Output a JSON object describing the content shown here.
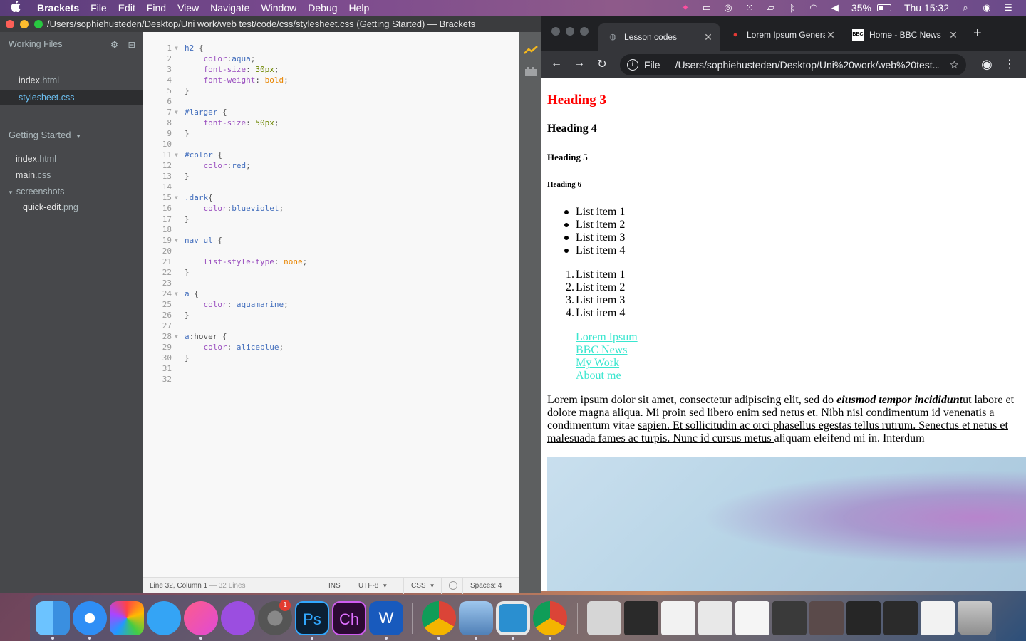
{
  "menubar": {
    "app_name": "Brackets",
    "menus": [
      "File",
      "Edit",
      "Find",
      "View",
      "Navigate",
      "Window",
      "Debug",
      "Help"
    ],
    "battery_percent": "35%",
    "clock": "Thu 15:32"
  },
  "brackets": {
    "title": "/Users/sophiehusteden/Desktop/Uni work/web test/code/css/stylesheet.css (Getting Started) — Brackets",
    "working_files_label": "Working Files",
    "working_files": [
      {
        "name": "index",
        "ext": ".html"
      },
      {
        "name": "stylesheet",
        "ext": ".css"
      }
    ],
    "project_title": "Getting Started",
    "project_tree": [
      {
        "name": "index",
        "ext": ".html"
      },
      {
        "name": "main",
        "ext": ".css"
      },
      {
        "name": "screenshots",
        "ext": ""
      },
      {
        "name": "quick-edit",
        "ext": ".png"
      }
    ],
    "line_numbers": [
      "1",
      "2",
      "3",
      "4",
      "5",
      "6",
      "7",
      "8",
      "9",
      "10",
      "11",
      "12",
      "13",
      "14",
      "15",
      "16",
      "17",
      "18",
      "19",
      "20",
      "21",
      "22",
      "23",
      "24",
      "25",
      "26",
      "27",
      "28",
      "29",
      "30",
      "31",
      "32"
    ],
    "status": {
      "position": "Line 32, Column 1",
      "lines": "— 32 Lines",
      "mode": "INS",
      "encoding": "UTF-8",
      "language": "CSS",
      "spaces": "Spaces:  4"
    }
  },
  "chrome": {
    "tabs": [
      {
        "title": "Lesson codes"
      },
      {
        "title": "Lorem Ipsum Generator"
      },
      {
        "title": "Home - BBC News"
      }
    ],
    "bbc_favicon": "BBC",
    "url_protocol": "File",
    "url": "/Users/sophiehusteden/Desktop/Uni%20work/web%20test...",
    "page": {
      "h3": "Heading 3",
      "h4": "Heading 4",
      "h5": "Heading 5",
      "h6": "Heading 6",
      "ul_items": [
        "List item 1",
        "List item 2",
        "List item 3",
        "List item 4"
      ],
      "ol_items": [
        "List item 1",
        "List item 2",
        "List item 3",
        "List item 4"
      ],
      "ol_numbers": [
        "1.",
        "2.",
        "3.",
        "4."
      ],
      "nav_links": [
        "Lorem Ipsum",
        "BBC News",
        "My Work",
        "About me"
      ],
      "para_start": "Lorem ipsum dolor sit amet, consectetur adipiscing elit, sed do ",
      "para_em": "eiusmod tempor incididunt",
      "para_mid": "ut labore et dolore magna aliqua. Mi proin sed libero enim sed netus et. Nibh nisl condimentum id venenatis a condimentum vitae ",
      "para_link": "sapien. Et sollicitudin ac orci phasellus egestas tellus rutrum. Senectus et netus et malesuada fames ac turpis. Nunc id cursus metus ",
      "para_end": "aliquam eleifend mi in. Interdum"
    }
  },
  "dock": {
    "settings_badge": "1",
    "ps_label": "Ps",
    "ch_label": "Ch",
    "word_label": "W"
  },
  "colors": {
    "brackets_sidebar": "#47484b",
    "brackets_editor": "#f8f8f8",
    "chrome_dark": "#202124",
    "selector_blue": "#446fbd",
    "property_purple": "#9a4fbf",
    "value_orange": "#e88501",
    "heading3_red": "#ff0000",
    "link_aquamarine": "#3ae6cf"
  }
}
